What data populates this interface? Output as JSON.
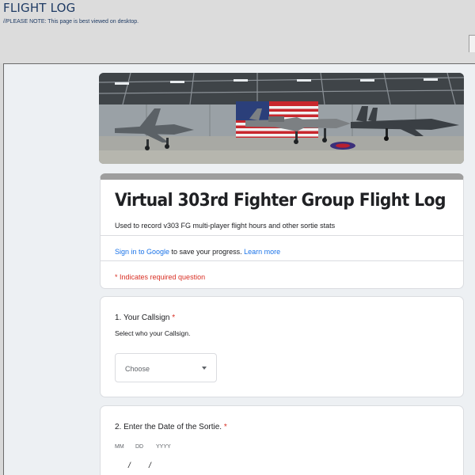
{
  "header": {
    "title": "FLIGHT LOG",
    "note": "//PLEASE NOTE: This page is best viewed on desktop."
  },
  "form": {
    "title": "Virtual 303rd Fighter Group Flight Log",
    "description": "Used to record v303 FG multi-player flight hours and other sortie stats",
    "signin": {
      "link_label": "Sign in to Google",
      "middle_text": " to save your progress. ",
      "learn_more": "Learn more"
    },
    "required_note": "* Indicates required question"
  },
  "questions": [
    {
      "title": "1. Your Callsign",
      "required_mark": "*",
      "help": "Select who your Callsign.",
      "select_value": "Choose"
    },
    {
      "title": "2. Enter the Date of the Sortie.",
      "required_mark": "*",
      "labels": {
        "mm": "MM",
        "dd": "DD",
        "yyyy": "YYYY"
      },
      "separator": "/"
    }
  ]
}
